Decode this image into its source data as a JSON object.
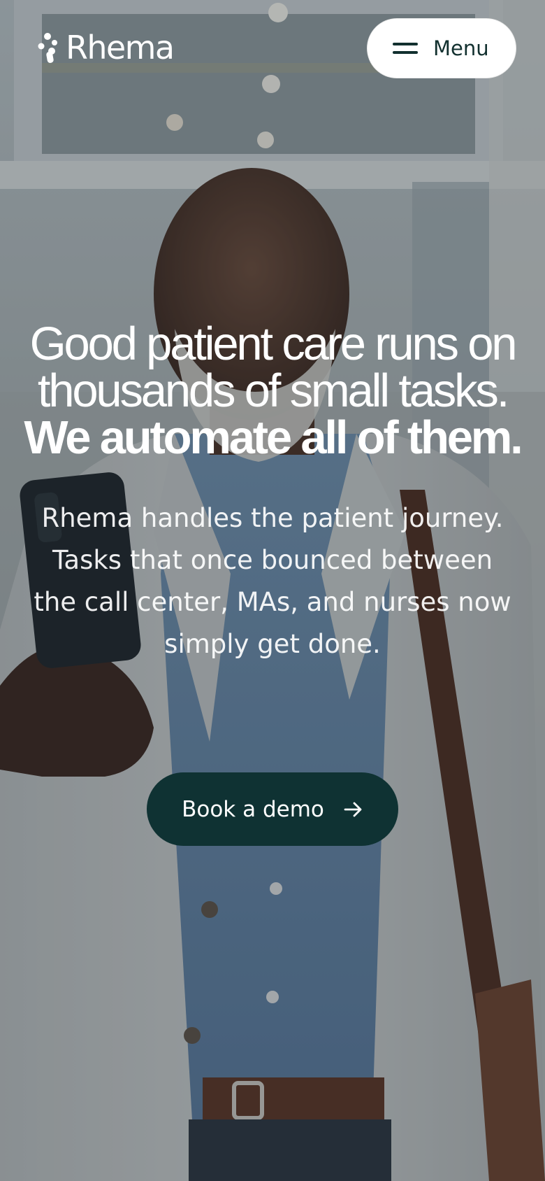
{
  "brand": {
    "name": "Rhema"
  },
  "nav": {
    "menu_label": "Menu"
  },
  "hero": {
    "headline_regular": "Good patient care runs on thousands of small tasks.",
    "headline_strong": "We automate all of them.",
    "subheadline": "Rhema handles the patient journey. Tasks that once bounced between the call center, MAs, and nurses now simply get done.",
    "cta_label": "Book a demo"
  },
  "icons": {
    "logo": "rhema-burst-icon",
    "menu": "hamburger-icon",
    "cta": "arrow-right-icon"
  },
  "colors": {
    "cta_background": "#0f3233",
    "menu_background": "#ffffff",
    "text_light": "#ffffff",
    "text_dark": "#12302f"
  }
}
